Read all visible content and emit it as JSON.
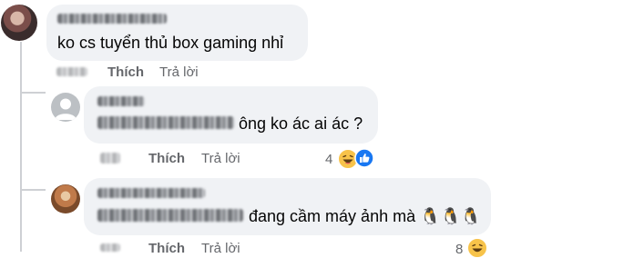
{
  "comments": [
    {
      "text": "ko cs tuyển thủ box gaming nhỉ",
      "like_label": "Thích",
      "reply_label": "Trả lời"
    },
    {
      "text": "ông ko ác ai ác ?",
      "like_label": "Thích",
      "reply_label": "Trả lời",
      "reaction_count": "4",
      "reactions": [
        "laughing-emoji",
        "like-icon"
      ]
    },
    {
      "text": "đang cầm máy ảnh mà 🐧🐧🐧",
      "like_label": "Thích",
      "reply_label": "Trả lời",
      "reaction_count": "8",
      "reactions": [
        "laughing-emoji"
      ]
    }
  ],
  "colors": {
    "bubble": "#f0f2f5",
    "secondary_text": "#65676b",
    "like_blue": "#1877f2",
    "thread_line": "#ced0d4"
  }
}
